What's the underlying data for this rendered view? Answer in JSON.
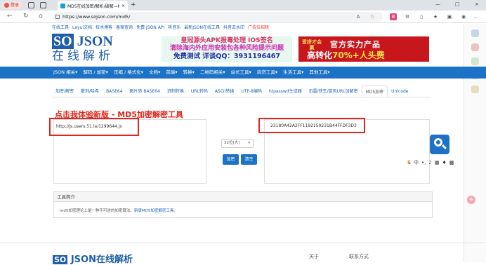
{
  "browser": {
    "profile_label": "登录",
    "tab_title": "MD5在线加密/解析/破解—MD5...",
    "close_glyph": "×",
    "newtab_glyph": "+",
    "url": "https://www.sojson.com/md5/",
    "window_min": "—",
    "window_max": "□",
    "window_close": "×"
  },
  "toplinks": [
    "在线工具",
    "Layui文档",
    "技术博客",
    "备案查询",
    "免费 JSON API",
    "听音乐",
    "最新JSON在线工具",
    "抖音去水印",
    "广告位招租"
  ],
  "logo": {
    "so": "SO",
    "json": "JSON",
    "tagline": "在线解析"
  },
  "ad1": {
    "line1": "皇冠源头APK报毒处理 IOS签名",
    "line2": "清除海内外应用安装包各种风险提示问题",
    "line3": "免费测试 详谈QQ：3931196467"
  },
  "ad2": {
    "logo": "爱拼才会赢",
    "line1": "官方实力产品",
    "line2a": "高转化",
    "line2b": "70%+人头费"
  },
  "nav": [
    "JSON 相关▾",
    "解码 / 加密▾",
    "压缩 / 格式化▾",
    "文档▾",
    "前端▾",
    "转换▾",
    "二维码相关▾",
    "站长工具▾",
    "房贷工具▾",
    "生活工具▾",
    "其他工具▾"
  ],
  "tabs": [
    "加密/解密",
    "散列/哈希",
    "BASE64",
    "图片转 BASE64",
    "进制转换",
    "URL转码",
    "ASCII转换",
    "UTF-8编码",
    "htpasswd生成器",
    "迅雷/快车/旋风URL加解密",
    "MD5加密",
    "Unicode"
  ],
  "heading": "点击我体验新版 - MD5加密解密工具",
  "input_value": "http://js.users.51.la/1299644.js",
  "output_value": "23180A42A2FF1192150231B44FFDF3D3",
  "select_value": "32位[大]",
  "encrypt_label": "加密",
  "clear_label": "清空",
  "panel": {
    "title": "工具简介",
    "desc": "md5加密理论上是一种不可逆的加密算法。",
    "link": "新版MD5加密解密工具。"
  },
  "footer": {
    "so": "SO",
    "text": "JSON在线解析",
    "about": "关于",
    "contact": "联系方式"
  },
  "colors": {
    "primary": "#1b72c6",
    "accent_red": "#e1251b"
  }
}
